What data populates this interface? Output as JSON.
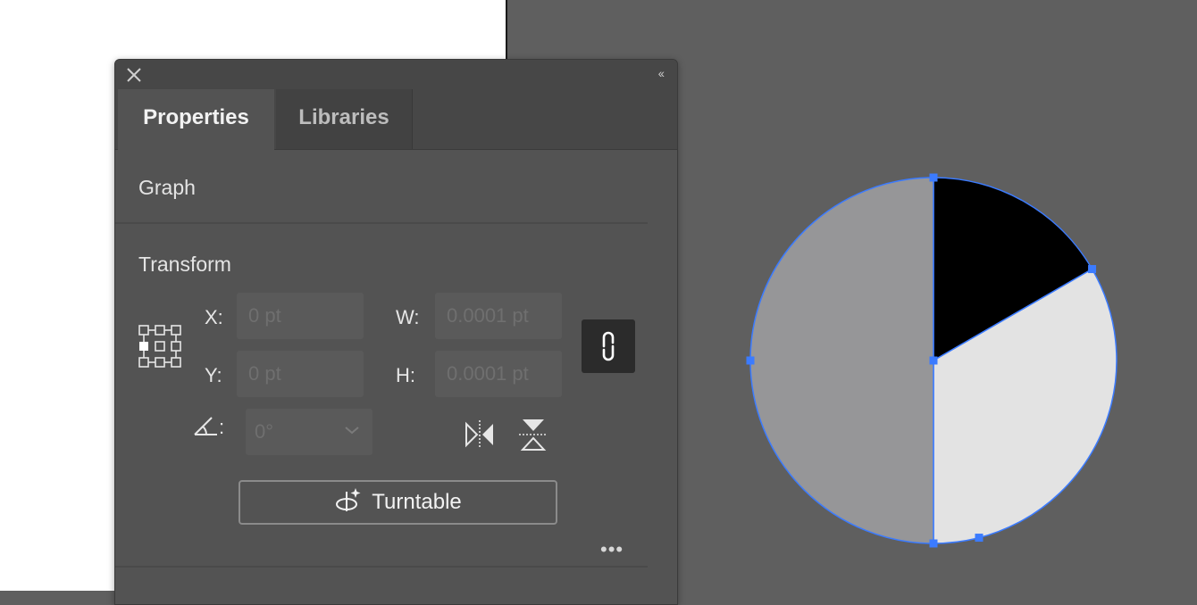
{
  "canvas": {
    "pie_chart": {
      "slices": [
        {
          "color": "#000000",
          "fraction": 0.1667
        },
        {
          "color": "#e3e3e3",
          "fraction": 0.3333
        },
        {
          "color": "#969698",
          "fraction": 0.5
        }
      ],
      "selection_color": "#3b7bff"
    }
  },
  "panel": {
    "collapse_label": "‹‹",
    "tabs": [
      {
        "label": "Properties",
        "active": true
      },
      {
        "label": "Libraries",
        "active": false
      }
    ],
    "selection_type": "Graph",
    "transform": {
      "title": "Transform",
      "x_label": "X:",
      "x_value": "0 pt",
      "y_label": "Y:",
      "y_value": "0 pt",
      "w_label": "W:",
      "w_value": "0.0001 pt",
      "h_label": "H:",
      "h_value": "0.0001 pt",
      "angle_label": ":",
      "angle_value": "0°"
    },
    "turntable_label": "Turntable",
    "more_label": "•••"
  }
}
